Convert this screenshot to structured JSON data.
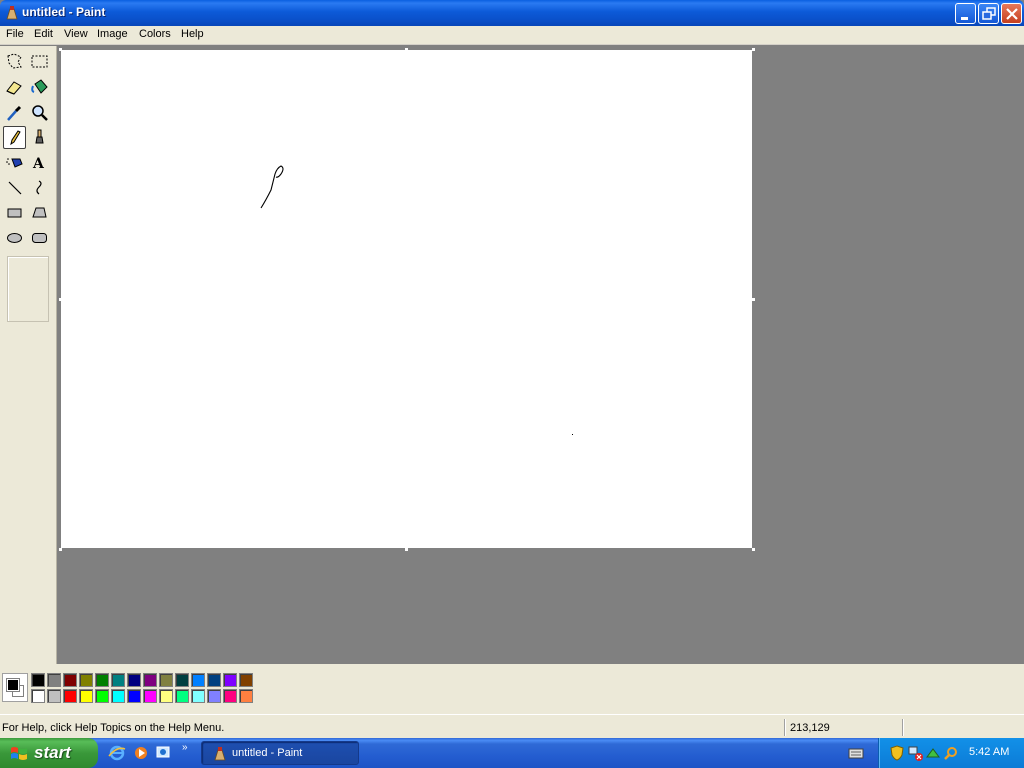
{
  "window": {
    "title": "untitled - Paint"
  },
  "menu": {
    "items": [
      {
        "label": "File"
      },
      {
        "label": "Edit"
      },
      {
        "label": "View"
      },
      {
        "label": "Image"
      },
      {
        "label": "Colors"
      },
      {
        "label": "Help"
      }
    ]
  },
  "toolbox": {
    "tools": [
      {
        "name": "free-form-select-tool-icon"
      },
      {
        "name": "select-tool-icon"
      },
      {
        "name": "eraser-tool-icon"
      },
      {
        "name": "fill-tool-icon"
      },
      {
        "name": "pick-color-tool-icon"
      },
      {
        "name": "magnifier-tool-icon"
      },
      {
        "name": "pencil-tool-icon",
        "active": true
      },
      {
        "name": "brush-tool-icon"
      },
      {
        "name": "airbrush-tool-icon"
      },
      {
        "name": "text-tool-icon"
      },
      {
        "name": "line-tool-icon"
      },
      {
        "name": "curve-tool-icon"
      },
      {
        "name": "rectangle-tool-icon"
      },
      {
        "name": "polygon-tool-icon"
      },
      {
        "name": "ellipse-tool-icon"
      },
      {
        "name": "rounded-rectangle-tool-icon"
      }
    ]
  },
  "colors": {
    "foreground": "#000000",
    "background": "#ffffff",
    "palette_top": [
      "#000000",
      "#808080",
      "#800000",
      "#808000",
      "#008000",
      "#008080",
      "#000080",
      "#800080",
      "#808040",
      "#004040",
      "#0080ff",
      "#004080",
      "#8000ff",
      "#804000"
    ],
    "palette_bottom": [
      "#ffffff",
      "#c0c0c0",
      "#ff0000",
      "#ffff00",
      "#00ff00",
      "#00ffff",
      "#0000ff",
      "#ff00ff",
      "#ffff80",
      "#00ff80",
      "#80ffff",
      "#8080ff",
      "#ff0080",
      "#ff8040"
    ]
  },
  "status": {
    "help_text": "For Help, click Help Topics on the Help Menu.",
    "coordinates": "213,129"
  },
  "taskbar": {
    "start_label": "start",
    "task_label": "untitled - Paint",
    "clock": "5:42 AM",
    "quick_launch_chevron": "»"
  }
}
